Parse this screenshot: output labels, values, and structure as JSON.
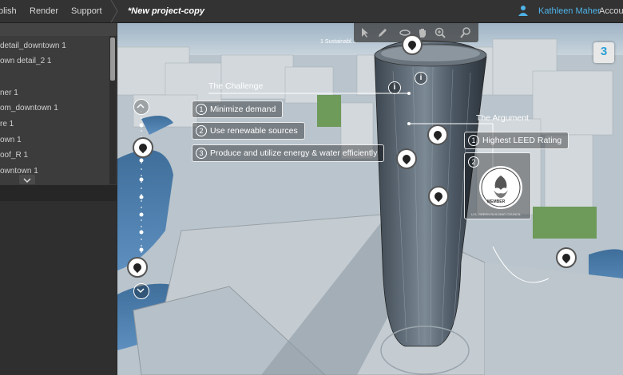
{
  "topbar": {
    "menu": [
      "blish",
      "Render",
      "Support"
    ],
    "project_title": "*New project-copy",
    "user_name": "Kathleen Maher",
    "account_label": "Accour"
  },
  "layers": [
    "detail_downtown 1",
    "own detail_2 1",
    "ner 1",
    "om_downtown 1",
    "re 1",
    "own 1",
    "oof_R 1",
    "owntown 1"
  ],
  "viewport": {
    "top_label": "1 Sustainabl...",
    "challenge": {
      "title": "The Challenge",
      "items": [
        {
          "num": "1",
          "text": "Minimize demand"
        },
        {
          "num": "2",
          "text": "Use renewable sources"
        },
        {
          "num": "3",
          "text": "Produce and utilize energy & water efficiently"
        }
      ]
    },
    "argument": {
      "title": "The Argument",
      "items": [
        {
          "num": "1",
          "text": "Highest LEED Rating"
        },
        {
          "num": "2",
          "text": ""
        }
      ]
    },
    "badge_text": "U.S. GREEN BUILDING COUNCIL",
    "badge_member": "MEMBER",
    "nav_cube_label": "3",
    "info_label": "i"
  },
  "colors": {
    "accent": "#4fb3e8",
    "topbar": "#333333",
    "panel": "#3a3a3a"
  }
}
